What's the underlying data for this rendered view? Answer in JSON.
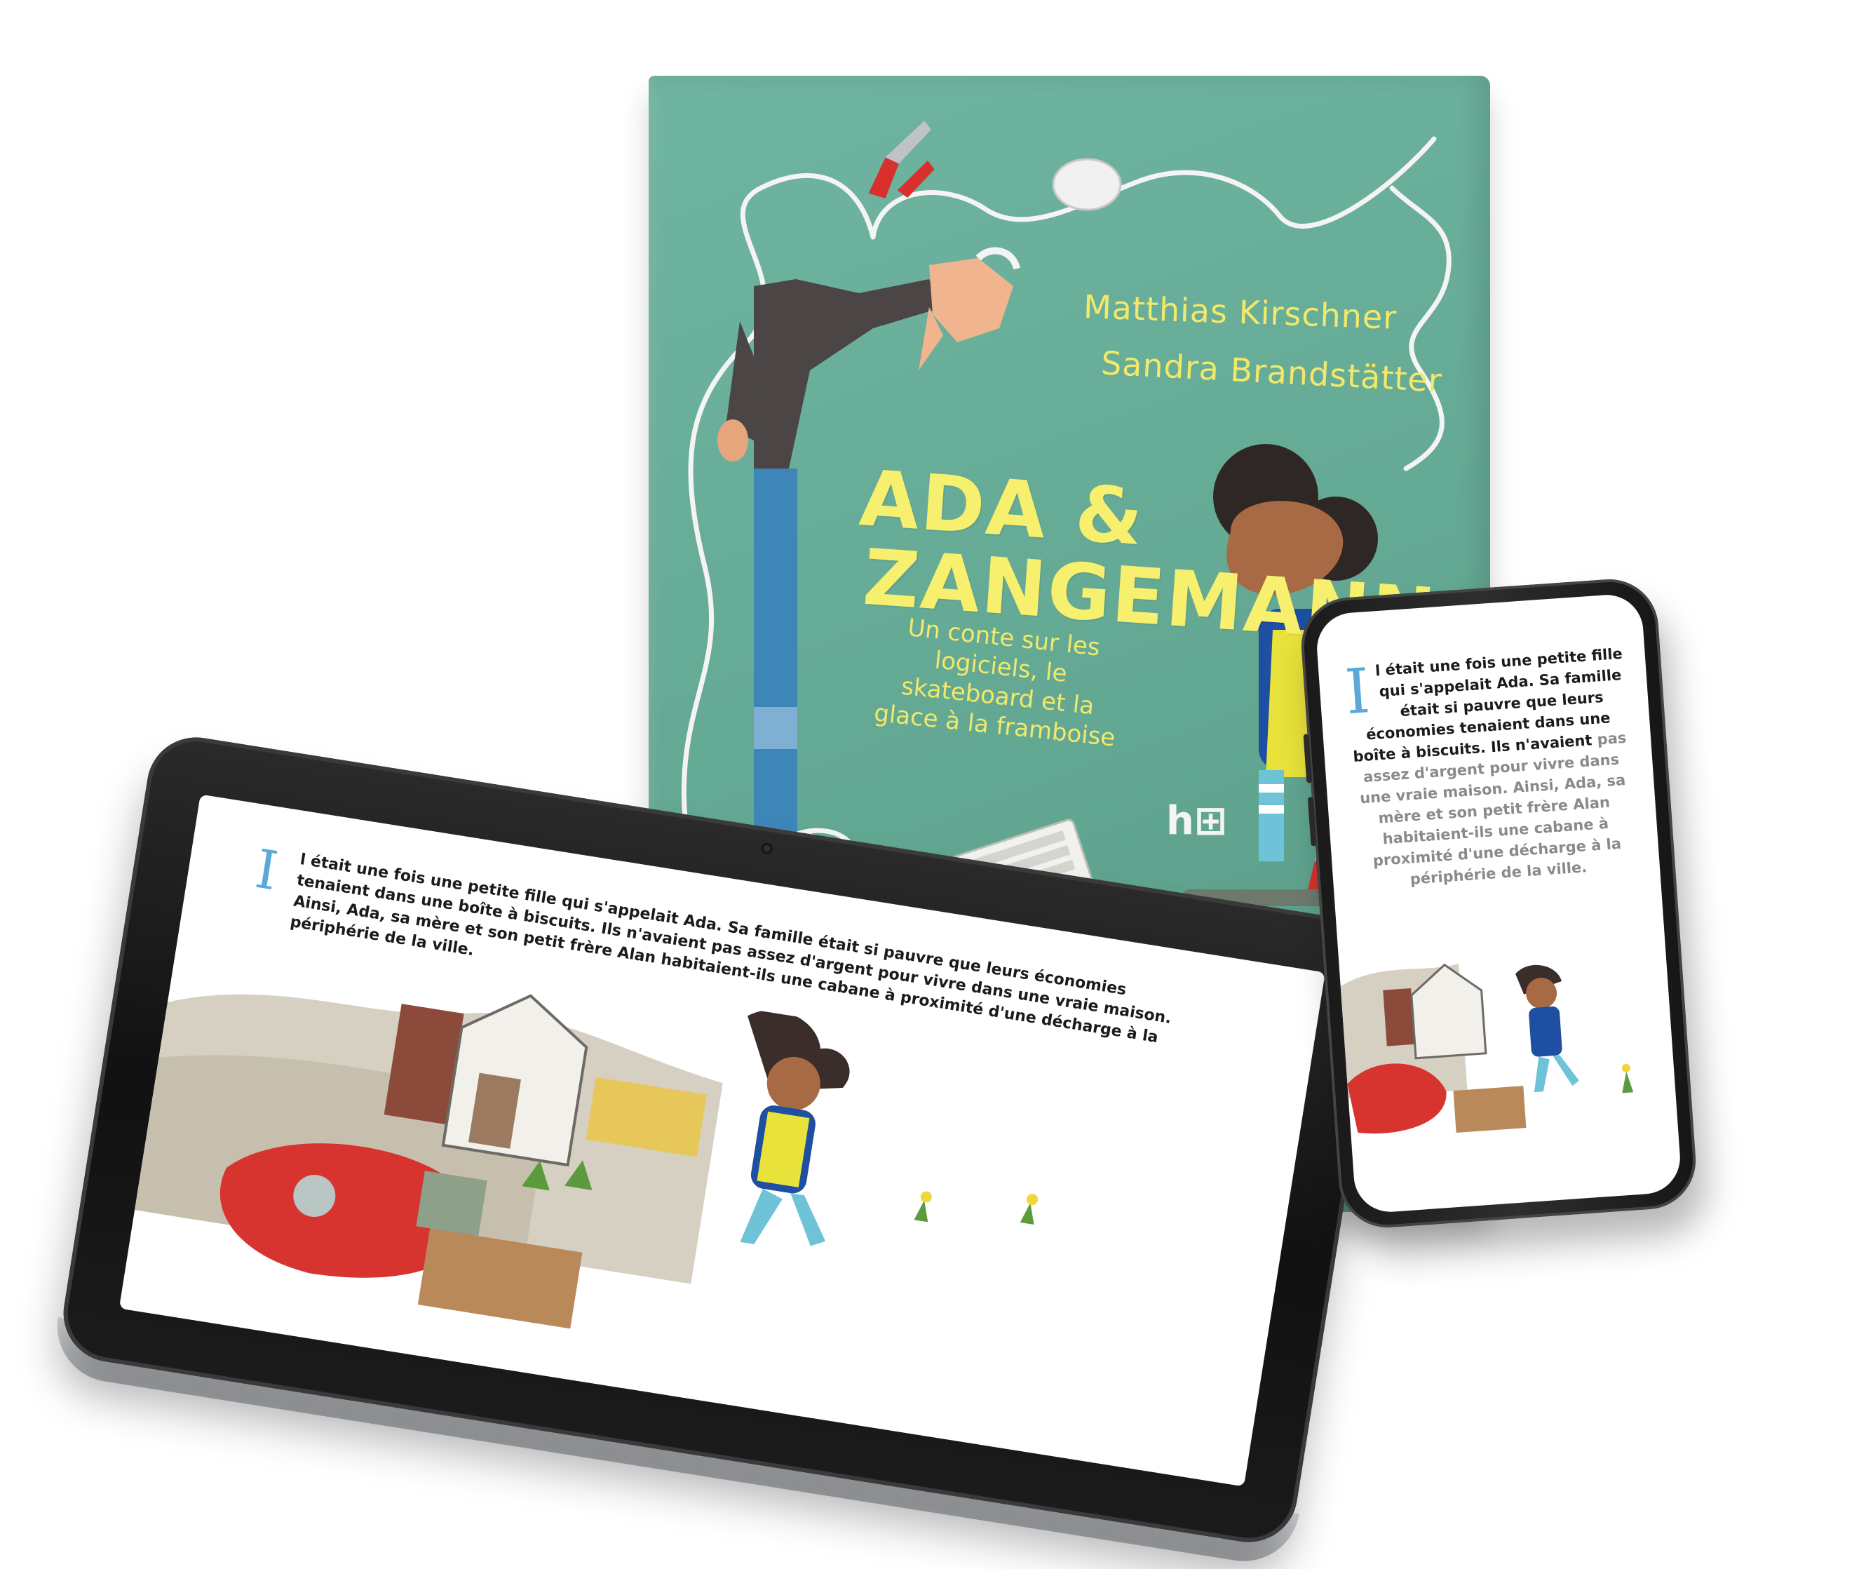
{
  "book": {
    "authors": [
      "Matthias Kirschner",
      "Sandra Brandstätter"
    ],
    "title_line1": "ADA &",
    "title_line2": "ZANGEMANN",
    "subtitle": "Un conte sur les logiciels, le skateboard et la glace à la framboise",
    "cover_color": "#66ad98",
    "accent_color": "#f4ec6c"
  },
  "tablet": {
    "dropcap": "I",
    "text": "l était une fois une petite fille qui s'appelait Ada. Sa famille était si pauvre que leurs économies tenaient dans une boîte à biscuits. Ils n'avaient pas assez d'argent pour vivre dans une vraie maison. Ainsi, Ada, sa mère et son petit frère Alan habitaient-ils une cabane à proximité d'une décharge à la périphérie de la ville."
  },
  "phone": {
    "dropcap": "I",
    "text_dark": "l était une fois une petite fille qui s'appelait Ada. Sa famille était si pauvre que leurs économies tenaient dans une boîte à biscuits. Ils n'avaient",
    "text_faded": "pas assez d'argent pour vivre dans une vraie maison. Ainsi, Ada, sa mère et son petit frère Alan habitaient-ils une cabane à proximité d'une décharge à la périphérie de la ville."
  },
  "colors": {
    "dropcap": "#5aa9d8",
    "device_bezel": "#151515",
    "tablet_rim": "#c7c9cc"
  }
}
